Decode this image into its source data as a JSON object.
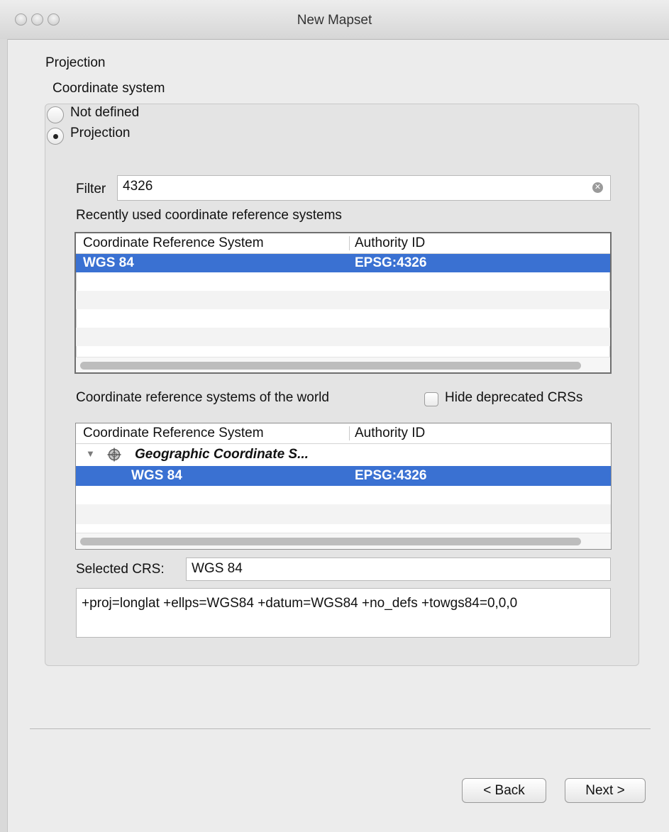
{
  "window": {
    "title": "New Mapset"
  },
  "section": {
    "title": "Projection",
    "coord_label": "Coordinate system"
  },
  "radios": [
    {
      "label": "Not defined",
      "checked": false
    },
    {
      "label": "Projection",
      "checked": true
    }
  ],
  "filter": {
    "label": "Filter",
    "value": "4326"
  },
  "recent": {
    "title": "Recently used coordinate reference systems",
    "columns": [
      "Coordinate Reference System",
      "Authority ID"
    ],
    "rows": [
      {
        "name": "WGS 84",
        "id": "EPSG:4326",
        "selected": true
      }
    ]
  },
  "world": {
    "title": "Coordinate reference systems of the world",
    "hide_deprecated_label": "Hide deprecated CRSs",
    "hide_deprecated_checked": false,
    "columns": [
      "Coordinate Reference System",
      "Authority ID"
    ],
    "group_label": "Geographic Coordinate S...",
    "rows": [
      {
        "name": "WGS 84",
        "id": "EPSG:4326",
        "selected": true
      }
    ]
  },
  "selected_crs": {
    "label": "Selected CRS:",
    "value": "WGS 84"
  },
  "proj_string": "+proj=longlat +ellps=WGS84 +datum=WGS84 +no_defs +towgs84=0,0,0",
  "buttons": {
    "back": "< Back",
    "next": "Next >"
  },
  "colors": {
    "selection": "#3a71d2"
  }
}
